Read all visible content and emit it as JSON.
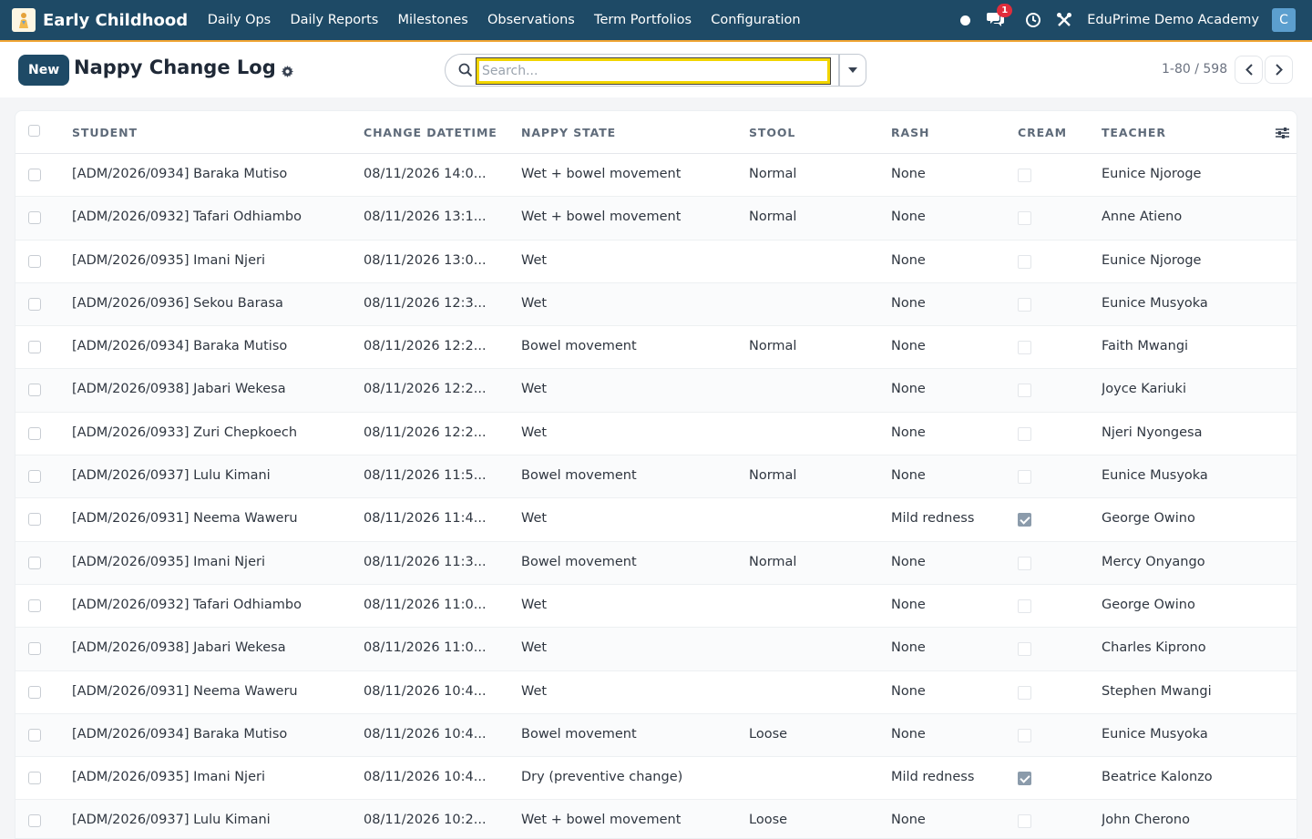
{
  "app": {
    "title": "Early Childhood",
    "nav": [
      "Daily Ops",
      "Daily Reports",
      "Milestones",
      "Observations",
      "Term Portfolios",
      "Configuration"
    ],
    "notifications_count": "1",
    "company": "EduPrime Demo Academy",
    "avatar_initial": "C"
  },
  "header": {
    "new_label": "New",
    "title": "Nappy Change Log",
    "search_placeholder": "Search...",
    "pager": "1-80 / 598"
  },
  "table": {
    "columns": [
      "STUDENT",
      "CHANGE DATETIME",
      "NAPPY STATE",
      "STOOL",
      "RASH",
      "CREAM",
      "TEACHER"
    ],
    "rows": [
      {
        "student": "[ADM/2026/0934] Baraka Mutiso",
        "datetime": "08/11/2026 14:0...",
        "state": "Wet + bowel movement",
        "stool": "Normal",
        "rash": "None",
        "cream": false,
        "teacher": "Eunice Njoroge"
      },
      {
        "student": "[ADM/2026/0932] Tafari Odhiambo",
        "datetime": "08/11/2026 13:1...",
        "state": "Wet + bowel movement",
        "stool": "Normal",
        "rash": "None",
        "cream": false,
        "teacher": "Anne Atieno"
      },
      {
        "student": "[ADM/2026/0935] Imani Njeri",
        "datetime": "08/11/2026 13:0...",
        "state": "Wet",
        "stool": "",
        "rash": "None",
        "cream": false,
        "teacher": "Eunice Njoroge"
      },
      {
        "student": "[ADM/2026/0936] Sekou Barasa",
        "datetime": "08/11/2026 12:3...",
        "state": "Wet",
        "stool": "",
        "rash": "None",
        "cream": false,
        "teacher": "Eunice Musyoka"
      },
      {
        "student": "[ADM/2026/0934] Baraka Mutiso",
        "datetime": "08/11/2026 12:2...",
        "state": "Bowel movement",
        "stool": "Normal",
        "rash": "None",
        "cream": false,
        "teacher": "Faith Mwangi"
      },
      {
        "student": "[ADM/2026/0938] Jabari Wekesa",
        "datetime": "08/11/2026 12:2...",
        "state": "Wet",
        "stool": "",
        "rash": "None",
        "cream": false,
        "teacher": "Joyce Kariuki"
      },
      {
        "student": "[ADM/2026/0933] Zuri Chepkoech",
        "datetime": "08/11/2026 12:2...",
        "state": "Wet",
        "stool": "",
        "rash": "None",
        "cream": false,
        "teacher": "Njeri Nyongesa"
      },
      {
        "student": "[ADM/2026/0937] Lulu Kimani",
        "datetime": "08/11/2026 11:5...",
        "state": "Bowel movement",
        "stool": "Normal",
        "rash": "None",
        "cream": false,
        "teacher": "Eunice Musyoka"
      },
      {
        "student": "[ADM/2026/0931] Neema Waweru",
        "datetime": "08/11/2026 11:4...",
        "state": "Wet",
        "stool": "",
        "rash": "Mild redness",
        "cream": true,
        "teacher": "George Owino"
      },
      {
        "student": "[ADM/2026/0935] Imani Njeri",
        "datetime": "08/11/2026 11:3...",
        "state": "Bowel movement",
        "stool": "Normal",
        "rash": "None",
        "cream": false,
        "teacher": "Mercy Onyango"
      },
      {
        "student": "[ADM/2026/0932] Tafari Odhiambo",
        "datetime": "08/11/2026 11:0...",
        "state": "Wet",
        "stool": "",
        "rash": "None",
        "cream": false,
        "teacher": "George Owino"
      },
      {
        "student": "[ADM/2026/0938] Jabari Wekesa",
        "datetime": "08/11/2026 11:0...",
        "state": "Wet",
        "stool": "",
        "rash": "None",
        "cream": false,
        "teacher": "Charles Kiprono"
      },
      {
        "student": "[ADM/2026/0931] Neema Waweru",
        "datetime": "08/11/2026 10:4...",
        "state": "Wet",
        "stool": "",
        "rash": "None",
        "cream": false,
        "teacher": "Stephen Mwangi"
      },
      {
        "student": "[ADM/2026/0934] Baraka Mutiso",
        "datetime": "08/11/2026 10:4...",
        "state": "Bowel movement",
        "stool": "Loose",
        "rash": "None",
        "cream": false,
        "teacher": "Eunice Musyoka"
      },
      {
        "student": "[ADM/2026/0935] Imani Njeri",
        "datetime": "08/11/2026 10:4...",
        "state": "Dry (preventive change)",
        "stool": "",
        "rash": "Mild redness",
        "cream": true,
        "teacher": "Beatrice Kalonzo"
      },
      {
        "student": "[ADM/2026/0937] Lulu Kimani",
        "datetime": "08/11/2026 10:2...",
        "state": "Wet + bowel movement",
        "stool": "Loose",
        "rash": "None",
        "cream": false,
        "teacher": "John Cherono"
      }
    ]
  },
  "icons": {
    "brand": "child-logo-icon",
    "status": "status-dot-icon",
    "chat": "chat-icon",
    "activity": "clock-icon",
    "settings": "tools-icon",
    "gear": "gear-icon",
    "search": "search-icon",
    "dropdown": "caret-down-icon",
    "prev": "chevron-left-icon",
    "next": "chevron-right-icon",
    "columns": "sliders-icon"
  },
  "colors": {
    "navbar": "#1e4a66",
    "accent_border": "#f0a534",
    "badge": "#e02d3c",
    "primary_button": "#1e4a66"
  }
}
